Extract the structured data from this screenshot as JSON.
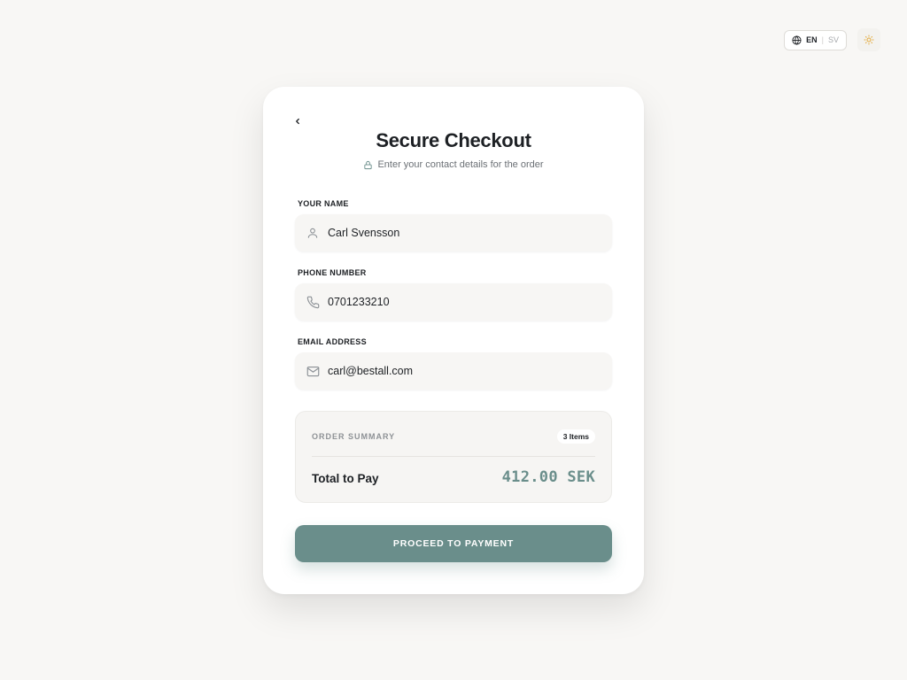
{
  "header": {
    "language": {
      "active": "EN",
      "separator": "|",
      "inactive": "SV"
    }
  },
  "checkout": {
    "title": "Secure Checkout",
    "subtitle": "Enter your contact details for the order",
    "fields": {
      "name": {
        "label": "YOUR NAME",
        "value": "Carl Svensson"
      },
      "phone": {
        "label": "PHONE NUMBER",
        "value": "0701233210"
      },
      "email": {
        "label": "EMAIL ADDRESS",
        "value": "carl@bestall.com"
      }
    },
    "summary": {
      "label": "ORDER SUMMARY",
      "items_badge": "3 Items",
      "total_label": "Total to Pay",
      "total_value": "412.00 SEK"
    },
    "submit_label": "PROCEED TO PAYMENT"
  },
  "icons": {
    "language": "globe-icon",
    "theme": "sun-icon",
    "back": "chevron-left-icon",
    "secure": "lock-icon",
    "name": "user-icon",
    "phone": "phone-icon",
    "email": "mail-icon"
  },
  "colors": {
    "accent": "#6a8e8b",
    "background": "#f8f7f5",
    "card": "#ffffff",
    "theme_icon": "#e3a93a"
  }
}
